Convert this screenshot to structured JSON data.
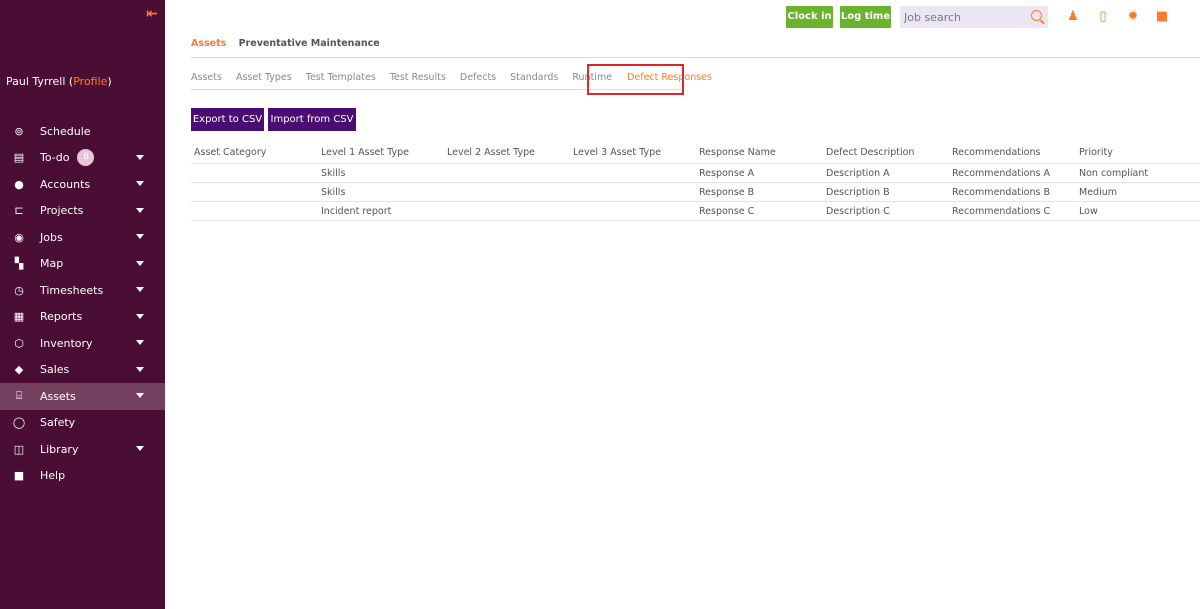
{
  "sidebar": {
    "user_name": "Paul Tyrrell",
    "profile_link": "Profile",
    "items": [
      {
        "label": "Schedule",
        "icon": "schedule-icon",
        "glyph": "⊚",
        "caret": false
      },
      {
        "label": "To-do",
        "icon": "todo-icon",
        "glyph": "▤",
        "caret": true,
        "badge": "6"
      },
      {
        "label": "Accounts",
        "icon": "accounts-icon",
        "glyph": "●",
        "caret": true
      },
      {
        "label": "Projects",
        "icon": "projects-icon",
        "glyph": "⊏",
        "caret": true
      },
      {
        "label": "Jobs",
        "icon": "jobs-icon",
        "glyph": "◉",
        "caret": true
      },
      {
        "label": "Map",
        "icon": "map-icon",
        "glyph": "▚",
        "caret": true
      },
      {
        "label": "Timesheets",
        "icon": "timesheets-icon",
        "glyph": "◷",
        "caret": true
      },
      {
        "label": "Reports",
        "icon": "reports-icon",
        "glyph": "▦",
        "caret": true
      },
      {
        "label": "Inventory",
        "icon": "inventory-icon",
        "glyph": "⬡",
        "caret": true
      },
      {
        "label": "Sales",
        "icon": "sales-icon",
        "glyph": "◆",
        "caret": true
      },
      {
        "label": "Assets",
        "icon": "assets-icon",
        "glyph": "⌸",
        "caret": true,
        "active": true
      },
      {
        "label": "Safety",
        "icon": "safety-icon",
        "glyph": "◯",
        "caret": false
      },
      {
        "label": "Library",
        "icon": "library-icon",
        "glyph": "◫",
        "caret": true
      },
      {
        "label": "Help",
        "icon": "help-icon",
        "glyph": "■",
        "caret": false
      }
    ]
  },
  "topbar": {
    "clock_in": "Clock in",
    "log_time": "Log time",
    "search_placeholder": "Job search"
  },
  "module_tabs": [
    "Assets",
    "Preventative Maintenance"
  ],
  "sub_tabs": [
    "Assets",
    "Asset Types",
    "Test Templates",
    "Test Results",
    "Defects",
    "Standards",
    "Runtime",
    "Defect Responses"
  ],
  "actions": {
    "export": "Export to CSV",
    "import": "Import from CSV"
  },
  "table": {
    "columns": [
      "Asset Category",
      "Level 1 Asset Type",
      "Level 2 Asset Type",
      "Level 3 Asset Type",
      "Response Name",
      "Defect Description",
      "Recommendations",
      "Priority"
    ],
    "rows": [
      [
        "",
        "Skills",
        "",
        "",
        "Response A",
        "Description A",
        "Recommendations A",
        "Non compliant"
      ],
      [
        "",
        "Skills",
        "",
        "",
        "Response B",
        "Description B",
        "Recommendations B",
        "Medium"
      ],
      [
        "",
        "Incident report",
        "",
        "",
        "Response C",
        "Description C",
        "Recommendations C",
        "Low"
      ]
    ]
  },
  "colors": {
    "sidebar_bg": "#4a0d33",
    "accent": "#ff7a2e",
    "green": "#6ab42d",
    "purple_button": "#4b0d73",
    "highlight": "#e0262b"
  }
}
